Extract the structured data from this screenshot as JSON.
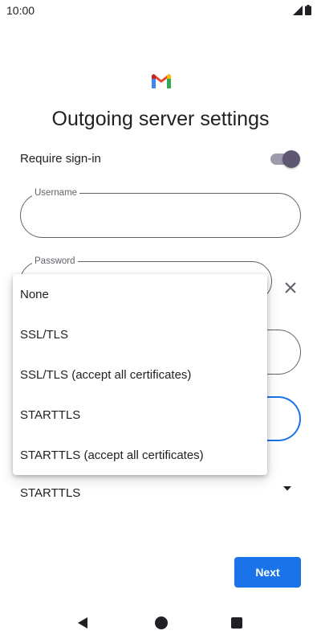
{
  "status_bar": {
    "time": "10:00",
    "icons": [
      "signal-icon",
      "battery-icon"
    ]
  },
  "header": {
    "logo": "gmail-icon",
    "title": "Outgoing server settings"
  },
  "require_signin": {
    "label": "Require sign-in",
    "enabled": true
  },
  "fields": {
    "username": {
      "label": "Username",
      "value": ""
    },
    "password": {
      "label": "Password",
      "value": ""
    }
  },
  "security_type": {
    "selected": "STARTTLS",
    "options": [
      "None",
      "SSL/TLS",
      "SSL/TLS (accept all certificates)",
      "STARTTLS",
      "STARTTLS (accept all certificates)"
    ]
  },
  "actions": {
    "next_label": "Next"
  },
  "nav_bar": {
    "buttons": [
      "back-icon",
      "home-icon",
      "recents-icon"
    ]
  },
  "colors": {
    "accent": "#1a73e8",
    "toggle_thumb": "#5f5873",
    "toggle_track": "#9e9aac",
    "text": "#202124",
    "outline": "#5f6368"
  }
}
